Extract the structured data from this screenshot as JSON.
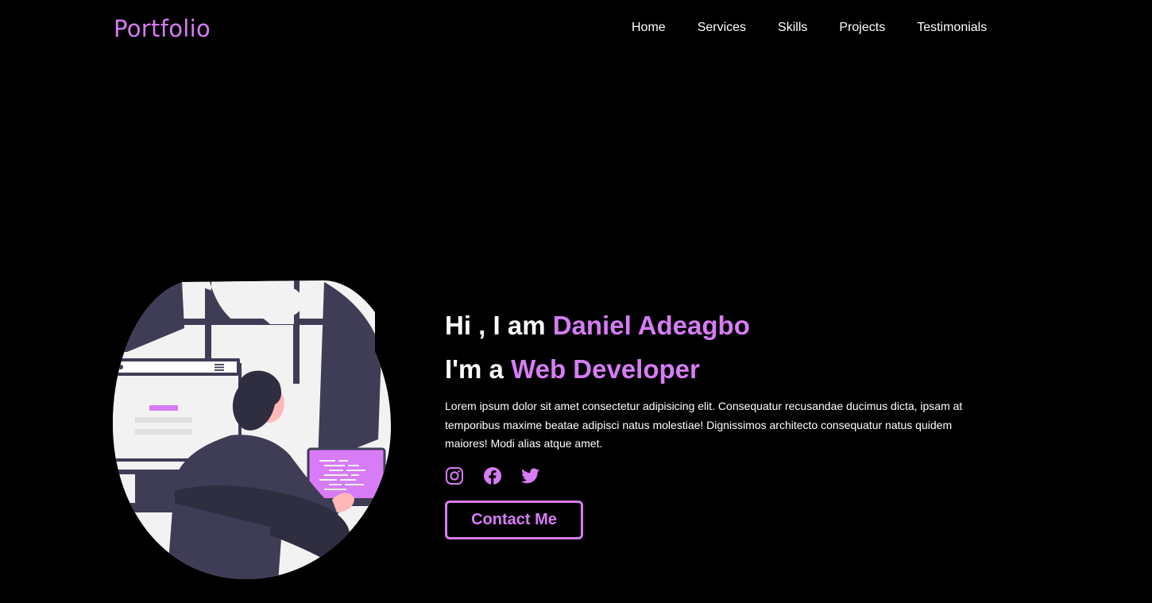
{
  "header": {
    "logo": "Portfolio",
    "nav": [
      "Home",
      "Services",
      "Skills",
      "Projects",
      "Testimonials"
    ]
  },
  "hero": {
    "greeting": "Hi , I am",
    "name": "Daniel Adeagbo",
    "role_prefix": "I'm a",
    "role": "Web Developer",
    "description": "Lorem ipsum dolor sit amet consectetur adipisicing elit. Consequatur recusandae ducimus dicta, ipsam at temporibus maxime beatae adipisci natus molestiae! Dignissimos architecto consequatur natus quidem maiores! Modi alias atque amet.",
    "socials": [
      "instagram-icon",
      "facebook-icon",
      "twitter-icon"
    ],
    "cta": "Contact Me"
  },
  "colors": {
    "background": "#000000",
    "accent": "#d77cf6",
    "text": "#ffffff",
    "illustration_dark": "#3f3d56",
    "illustration_light": "#f2f2f2"
  }
}
